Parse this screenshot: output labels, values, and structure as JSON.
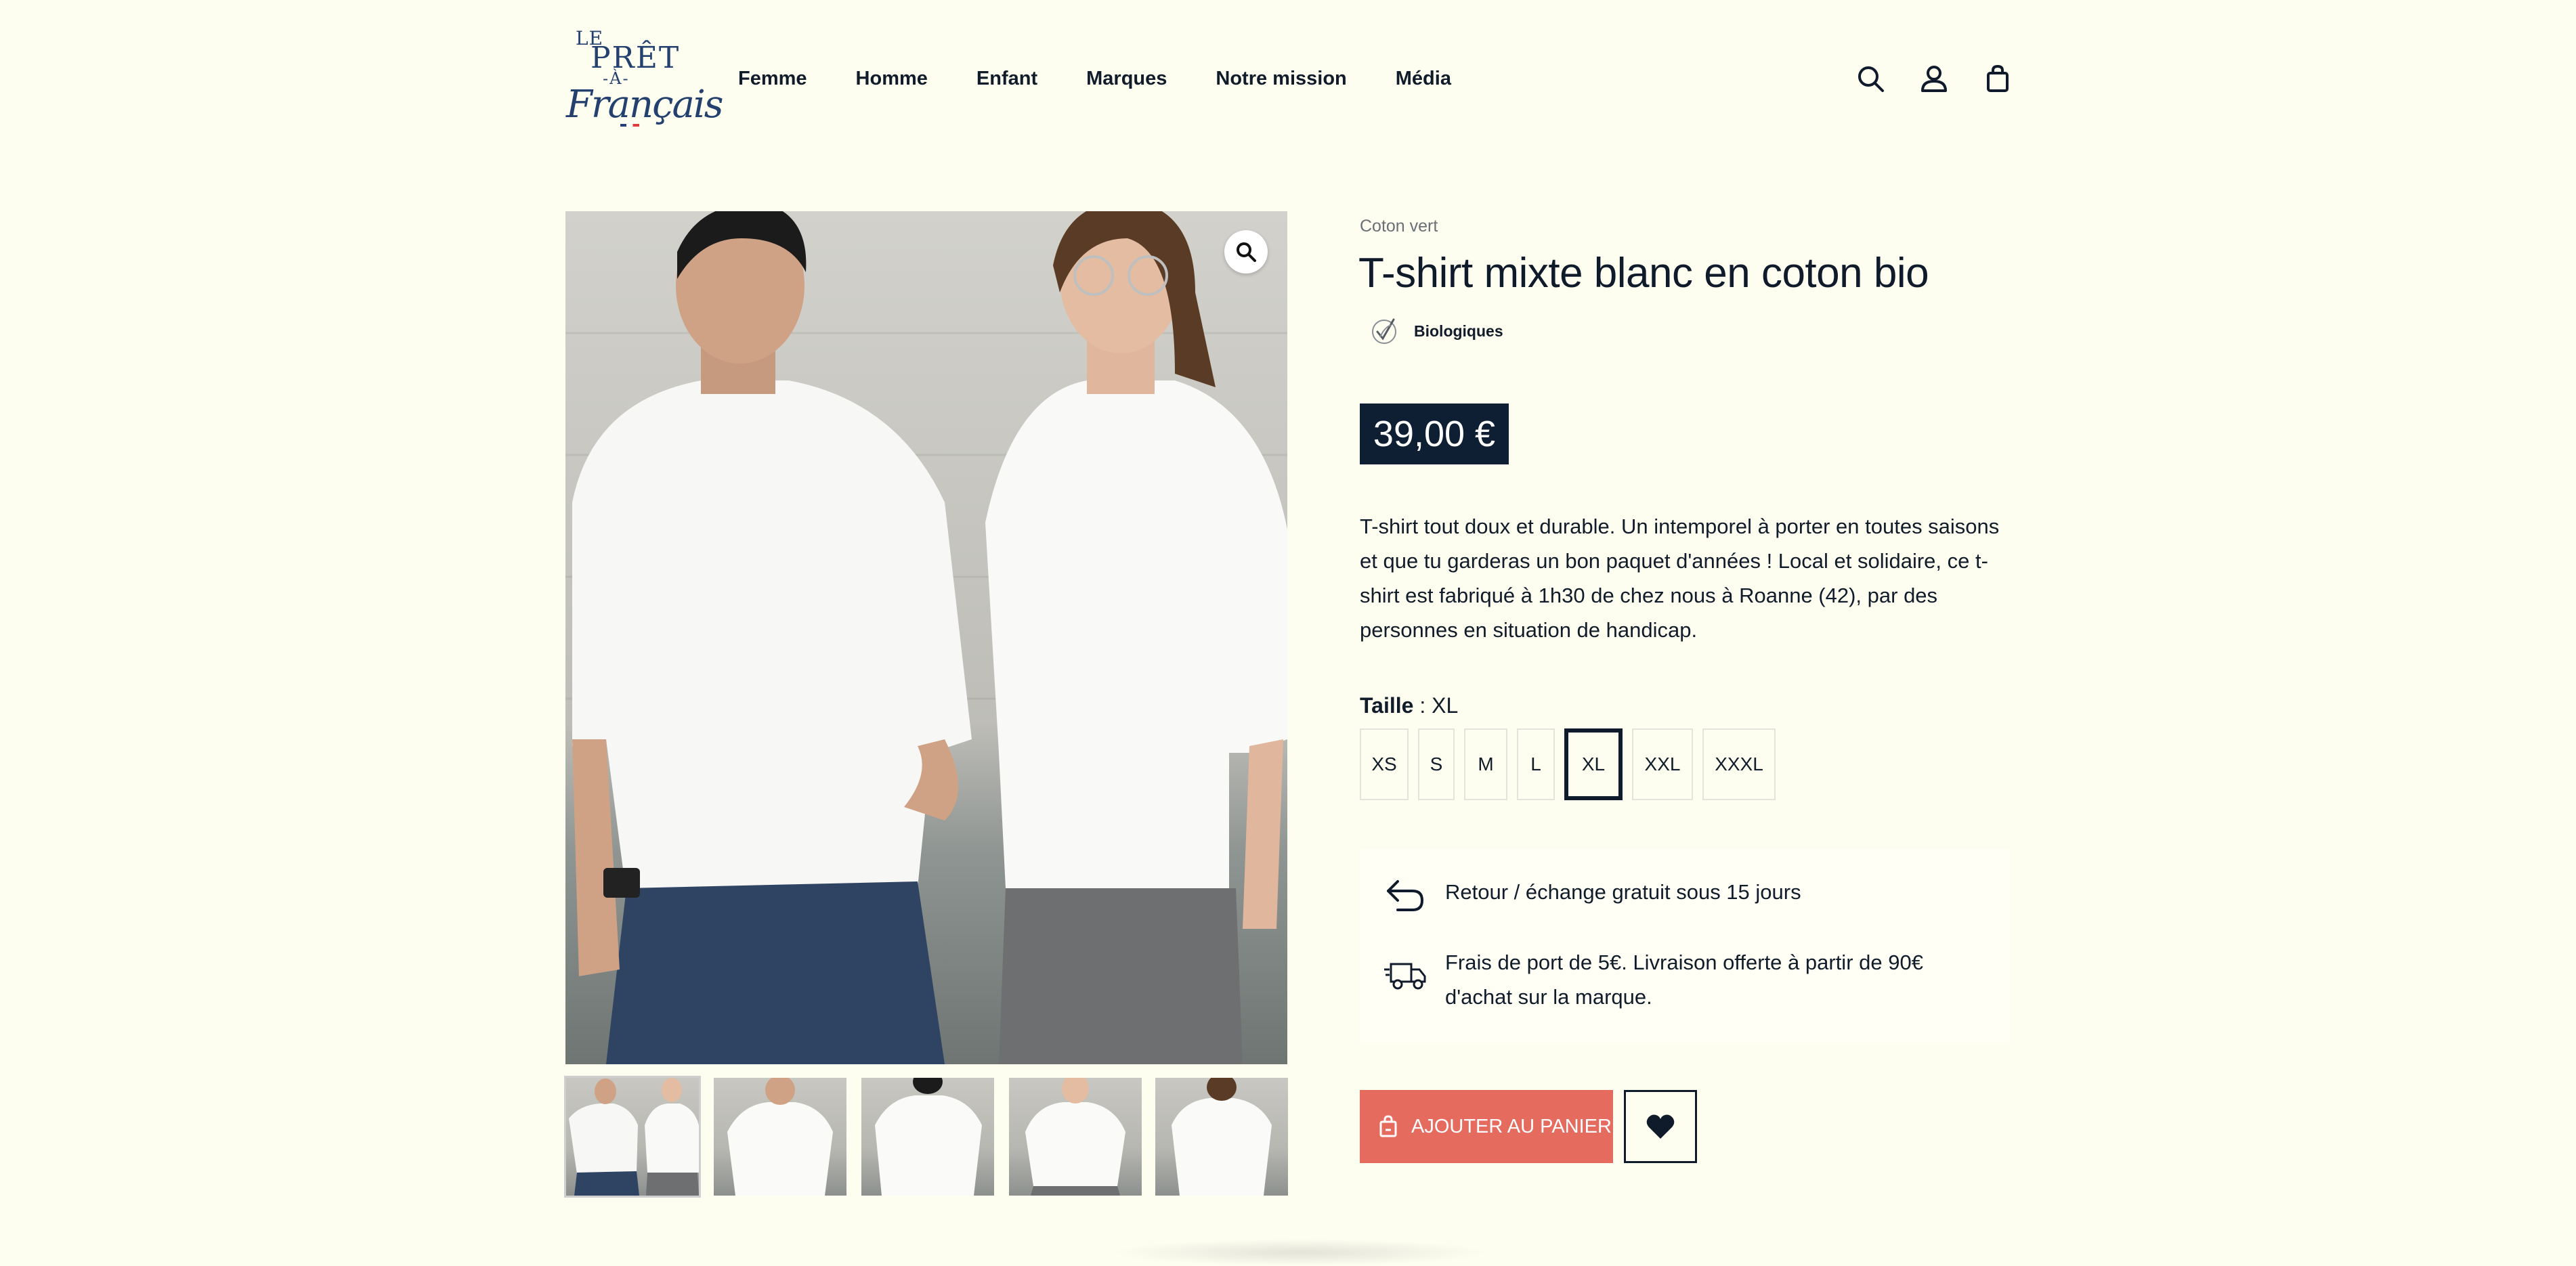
{
  "header": {
    "logo": {
      "line1": "LE",
      "line2": "PRÊT",
      "line3": "-À-",
      "line4": "Français"
    },
    "nav": [
      "Femme",
      "Homme",
      "Enfant",
      "Marques",
      "Notre mission",
      "Média"
    ],
    "icons": [
      "search-icon",
      "account-icon",
      "shopping-bag-icon"
    ]
  },
  "gallery": {
    "zoom_icon": "magnifier-icon",
    "thumbnail_count": 5,
    "active_thumbnail": 1
  },
  "product": {
    "brand": "Coton vert",
    "title": "T-shirt mixte blanc en coton bio",
    "tag": "Biologiques",
    "price": "39,00 €",
    "description": "T-shirt tout doux et durable. Un intemporel à porter en toutes saisons et que tu garderas un bon paquet d'années ! Local et solidaire, ce t-shirt est fabriqué à 1h30 de chez nous à Roanne (42), par des personnes en situation de handicap.",
    "size_label": "Taille",
    "size_separator": " : ",
    "selected_size": "XL",
    "sizes": [
      "XS",
      "S",
      "M",
      "L",
      "XL",
      "XXL",
      "XXXL"
    ]
  },
  "info": {
    "returns": "Retour / échange gratuit sous 15 jours",
    "shipping": "Frais de port de 5€. Livraison offerte à partir de 90€ d'achat sur la marque."
  },
  "actions": {
    "add_to_cart": "AJOUTER AU PANIER",
    "wishlist_icon": "heart-icon"
  },
  "colors": {
    "background": "#fdfdf0",
    "navy": "#0f1f33",
    "cta": "#e56b5f",
    "logo_blue": "#24406e"
  }
}
